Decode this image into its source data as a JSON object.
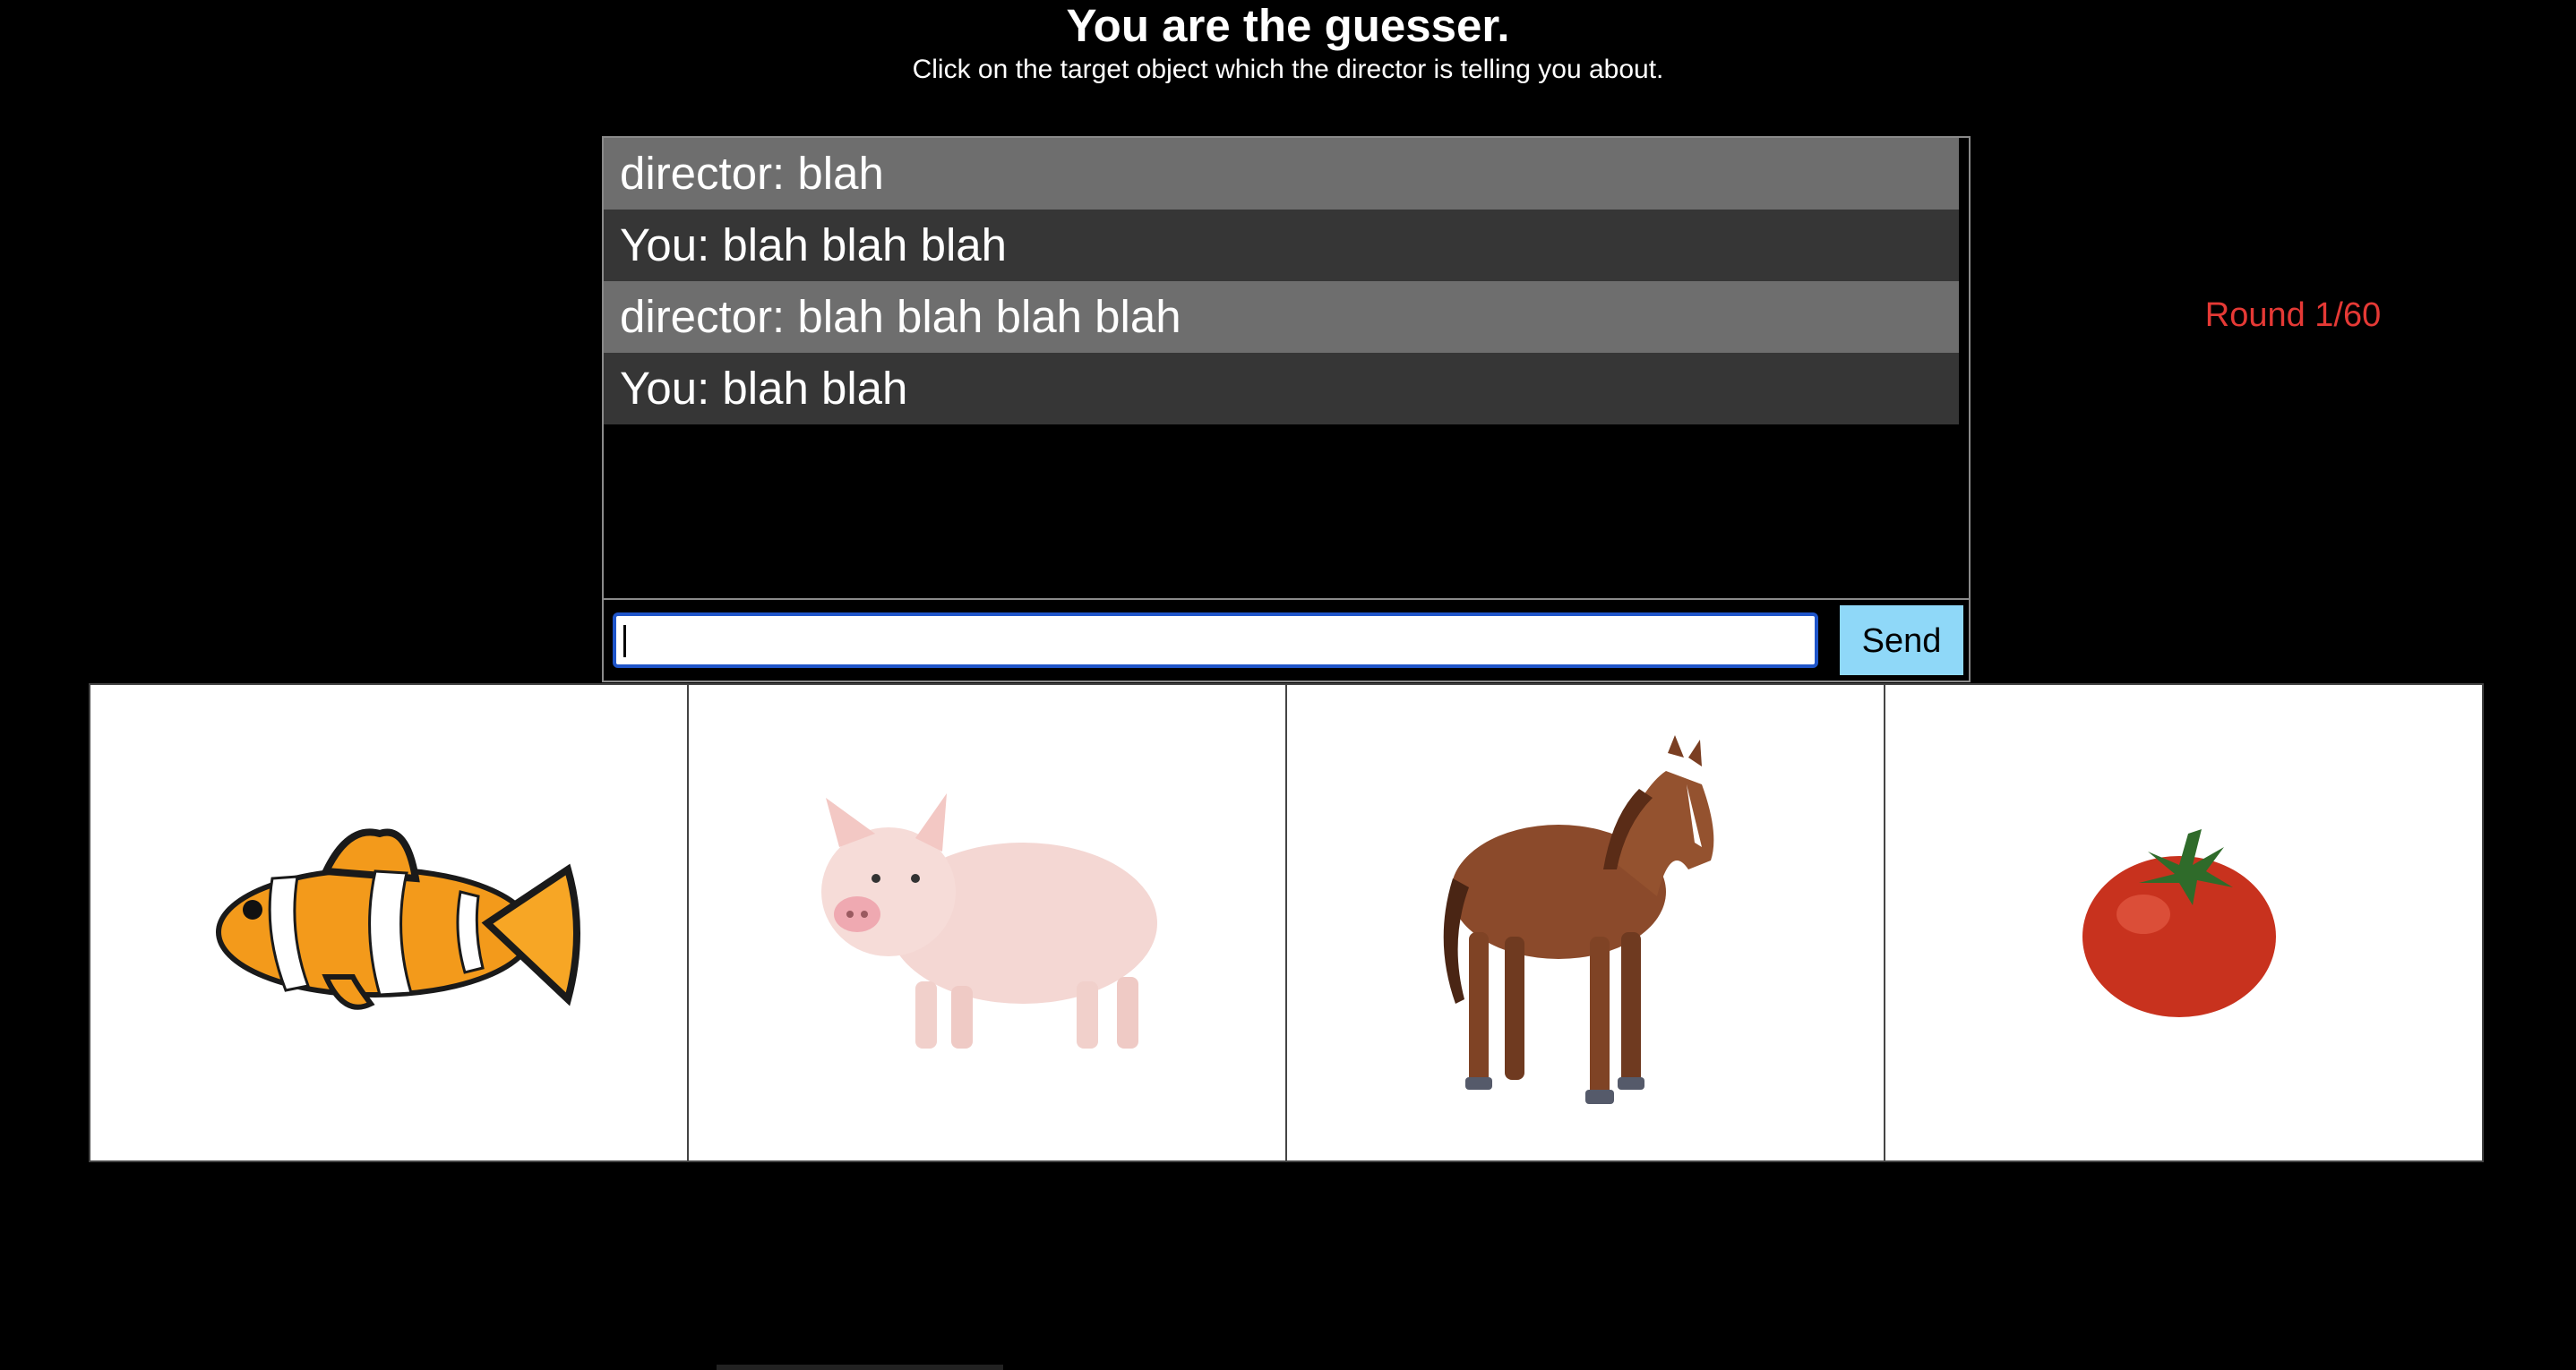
{
  "header": {
    "title": "You are the guesser.",
    "subtitle": "Click on the target object which the director is telling you about."
  },
  "chat": {
    "messages": [
      {
        "speaker": "director",
        "text": "director: blah"
      },
      {
        "speaker": "you",
        "text": "You: blah blah blah"
      },
      {
        "speaker": "director",
        "text": "director: blah blah blah blah"
      },
      {
        "speaker": "you",
        "text": "You: blah blah"
      }
    ],
    "input_value": "",
    "send_label": "Send"
  },
  "round": {
    "label": "Round 1/60",
    "color": "#e53935"
  },
  "objects": [
    {
      "icon": "clownfish-icon"
    },
    {
      "icon": "pig-icon"
    },
    {
      "icon": "horse-icon"
    },
    {
      "icon": "tomato-icon"
    }
  ],
  "colors": {
    "background": "#000000",
    "director_row": "#6e6e6e",
    "you_row": "#363636",
    "send_button": "#8fd8f8",
    "input_border": "#1f55c9"
  }
}
